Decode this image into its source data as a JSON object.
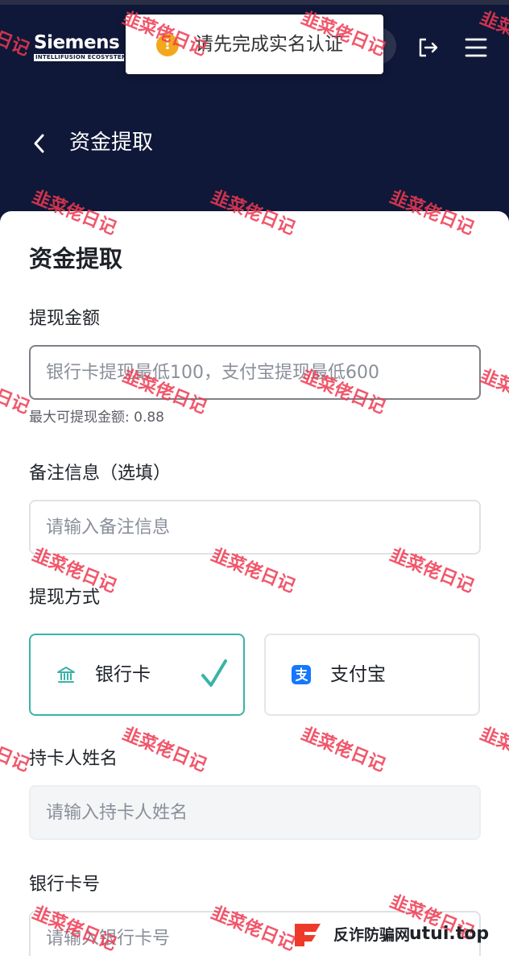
{
  "header": {
    "brand_name": "Siemens",
    "brand_sub": "INTELLIFUSION ECOSYSTEM",
    "icons": {
      "logout": "logout-icon",
      "menu": "menu-icon",
      "back": "chevron-left-icon"
    },
    "back_title": "资金提取"
  },
  "toast": {
    "icon": "warning-icon",
    "message": "请先完成实名认证",
    "icon_color": "#f2a81d"
  },
  "form": {
    "section_title": "资金提取",
    "amount": {
      "label": "提现金额",
      "placeholder": "银行卡提现最低100，支付宝提现最低600",
      "value": "",
      "hint": "最大可提现金额: 0.88"
    },
    "remark": {
      "label": "备注信息（选填）",
      "placeholder": "请输入备注信息",
      "value": ""
    },
    "method": {
      "label": "提现方式",
      "options": [
        {
          "label": "银行卡",
          "icon": "bank-icon",
          "selected": true
        },
        {
          "label": "支付宝",
          "icon": "alipay-icon",
          "selected": false
        }
      ]
    },
    "holder": {
      "label": "持卡人姓名",
      "placeholder": "请输入持卡人姓名",
      "value": ""
    },
    "card_number": {
      "label": "银行卡号",
      "placeholder": "请输入银行卡号",
      "value": ""
    }
  },
  "watermark": {
    "text": "韭菜佬日记"
  },
  "footer": {
    "icon": "brand-mark-icon",
    "text": "反诈防骗网",
    "domain": "utui.top"
  },
  "colors": {
    "header_bg": "#0f1838",
    "accent": "#3bb3a5",
    "alipay": "#1677ff",
    "watermark": "#ef3a52"
  }
}
